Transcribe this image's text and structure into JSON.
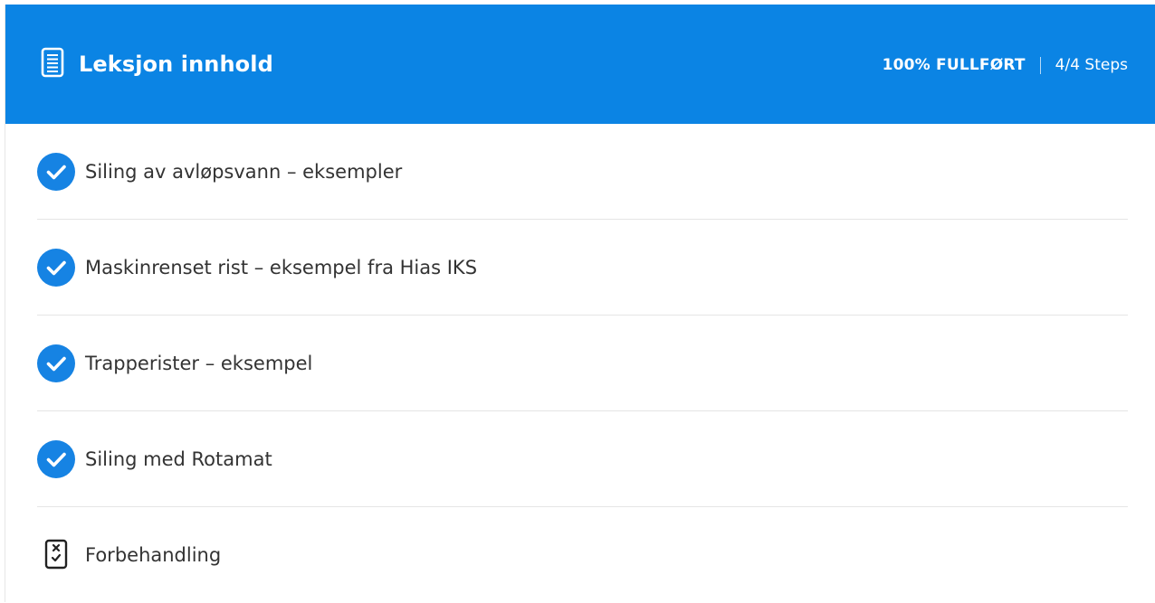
{
  "header": {
    "icon": "document-icon",
    "title": "Leksjon innhold",
    "progress_percent": "100% FULLFØRT",
    "progress_steps": "4/4 Steps"
  },
  "lessons": [
    {
      "label": "Siling av avløpsvann – eksempler",
      "icon": "check-circle-icon",
      "completed": true
    },
    {
      "label": "Maskinrenset rist – eksempel fra Hias IKS",
      "icon": "check-circle-icon",
      "completed": true
    },
    {
      "label": "Trapperister – eksempel",
      "icon": "check-circle-icon",
      "completed": true
    },
    {
      "label": "Siling med Rotamat",
      "icon": "check-circle-icon",
      "completed": true
    },
    {
      "label": "Forbehandling",
      "icon": "quiz-icon",
      "completed": false
    }
  ],
  "colors": {
    "header_bg": "#0b84e4",
    "check_bg": "#1683e3",
    "text": "#333333"
  }
}
